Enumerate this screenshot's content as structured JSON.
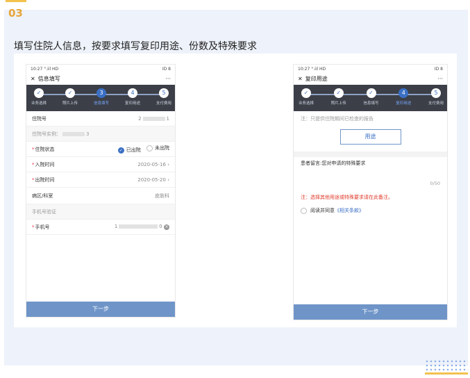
{
  "badge": "03",
  "heading": "填写住院人信息，按要求填写复印用途、份数及特殊要求",
  "phone1": {
    "status_time": "10:27",
    "status_signal": "°.iil HD",
    "status_right": "ID 8",
    "title": "信息填写",
    "menu": "···",
    "steps": [
      {
        "num": "✓",
        "label": "业务选择",
        "current": false
      },
      {
        "num": "✓",
        "label": "照片上传",
        "current": false
      },
      {
        "num": "3",
        "label": "信息填写",
        "current": true
      },
      {
        "num": "4",
        "label": "复印用途",
        "current": false
      },
      {
        "num": "5",
        "label": "支付费用",
        "current": false
      }
    ],
    "rows": {
      "inpatient_no_label": "住院号",
      "inpatient_no_val_a": "2",
      "inpatient_no_val_b": "1",
      "inpatient_example_label": "住院号实例：",
      "inpatient_example_val": "3",
      "status_label": "住院状态",
      "status_opt1": "已出院",
      "status_opt2": "未出院",
      "admit_label": "入院时间",
      "admit_val": "2020-05-16",
      "discharge_label": "出院时间",
      "discharge_val": "2020-05-20",
      "ward_label": "病区/科室",
      "ward_val": "皮肤科",
      "phone_verify_label": "手机号验证",
      "phone_label": "手机号",
      "phone_val_a": "1",
      "phone_val_b": "0"
    },
    "next": "下一步"
  },
  "phone2": {
    "status_time": "10:27",
    "status_signal": "°.iil HD",
    "status_right": "ID 8",
    "title": "复印用途",
    "menu": "···",
    "steps": [
      {
        "num": "✓",
        "label": "业务选择",
        "current": false
      },
      {
        "num": "✓",
        "label": "照片上传",
        "current": false
      },
      {
        "num": "✓",
        "label": "信息填写",
        "current": false
      },
      {
        "num": "4",
        "label": "复印用途",
        "current": true
      },
      {
        "num": "5",
        "label": "支付费用",
        "current": false
      }
    ],
    "note": "注：只提供住院期间已检查的报告",
    "use_button": "用途",
    "remark": "患者留言:您对申请的特殊要求",
    "count": "0/50",
    "warn": "注：选择其他用途或特殊要求请在此备注。",
    "agree_text": "阅读并同意",
    "agree_link": "《相关条款》",
    "next": "下一步"
  }
}
